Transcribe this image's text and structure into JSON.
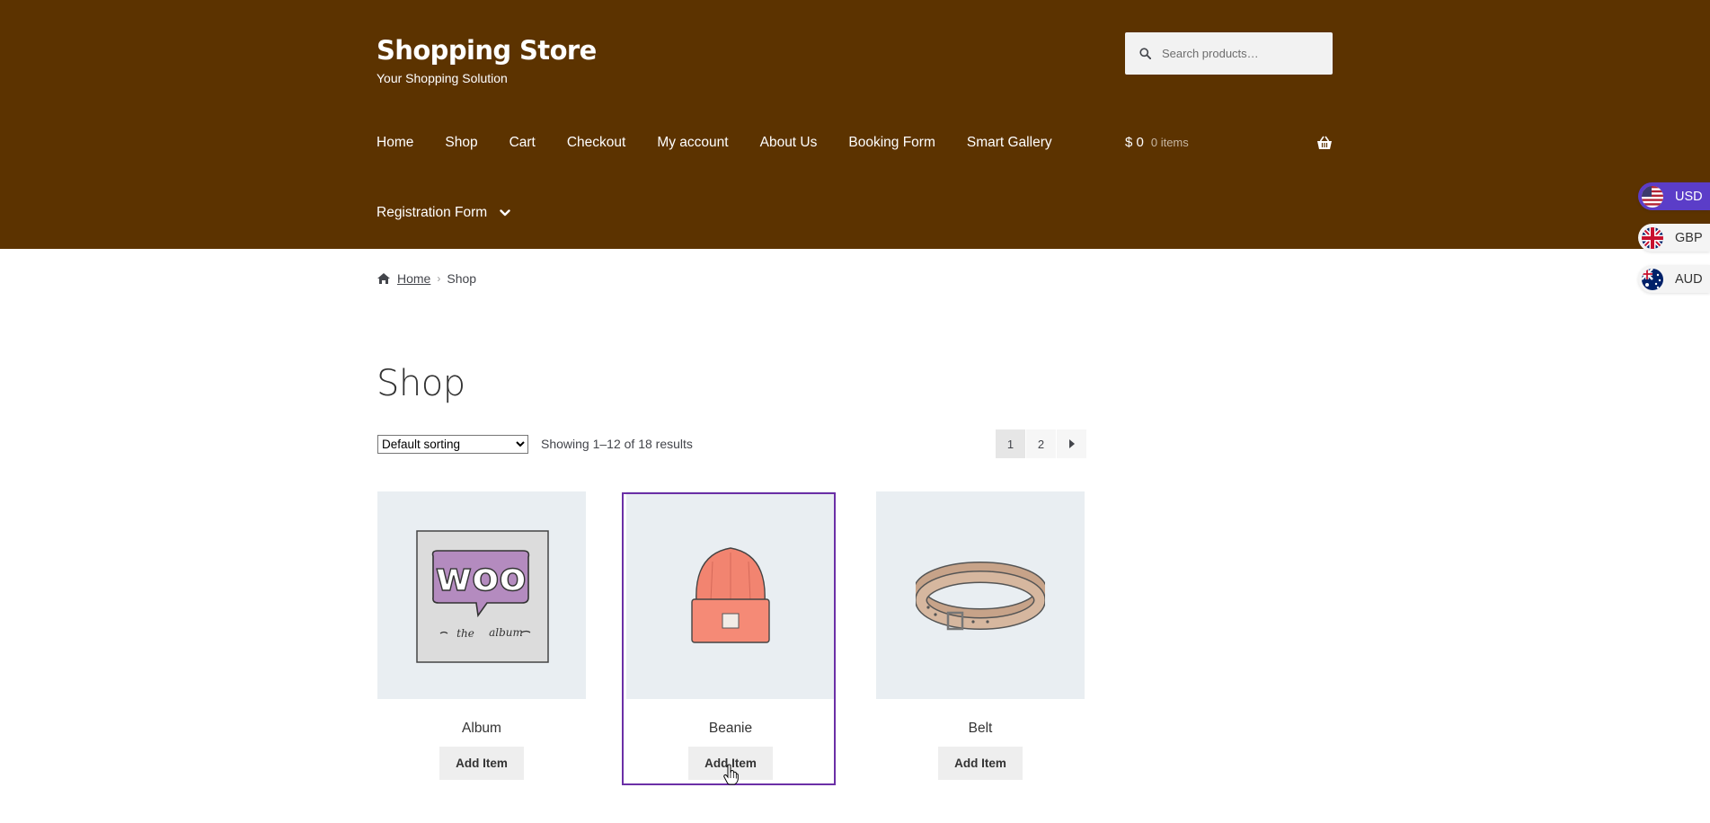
{
  "header": {
    "site_title": "Shopping Store",
    "tagline": "Your Shopping Solution",
    "search_placeholder": "Search products…",
    "nav": [
      "Home",
      "Shop",
      "Cart",
      "Checkout",
      "My account",
      "About Us",
      "Booking Form",
      "Smart Gallery"
    ],
    "nav_row2": "Registration Form",
    "cart": {
      "amount": "$ 0",
      "count": "0 items"
    },
    "background_color": "#5c3300"
  },
  "currency_switcher": [
    {
      "code": "USD",
      "flag": "us-flag-icon",
      "active": true
    },
    {
      "code": "GBP",
      "flag": "uk-flag-icon",
      "active": false
    },
    {
      "code": "AUD",
      "flag": "au-flag-icon",
      "active": false
    }
  ],
  "breadcrumb": {
    "home": "Home",
    "separator": "›",
    "current": "Shop"
  },
  "page": {
    "title": "Shop",
    "sorting": {
      "selected": "Default sorting",
      "options": [
        "Default sorting"
      ]
    },
    "result_count": "Showing 1–12 of 18 results",
    "pagination": {
      "pages": [
        "1",
        "2"
      ],
      "current": "1",
      "next_icon": "caret-right-icon"
    }
  },
  "products": [
    {
      "name": "Album",
      "button": "Add Item",
      "image": "woo-album-image"
    },
    {
      "name": "Beanie",
      "button": "Add Item",
      "image": "beanie-image",
      "focused": true
    },
    {
      "name": "Belt",
      "button": "Add Item",
      "image": "belt-image"
    }
  ],
  "colors": {
    "accent_outline": "#6b2fa6",
    "currency_active": "#5b3dc8"
  }
}
